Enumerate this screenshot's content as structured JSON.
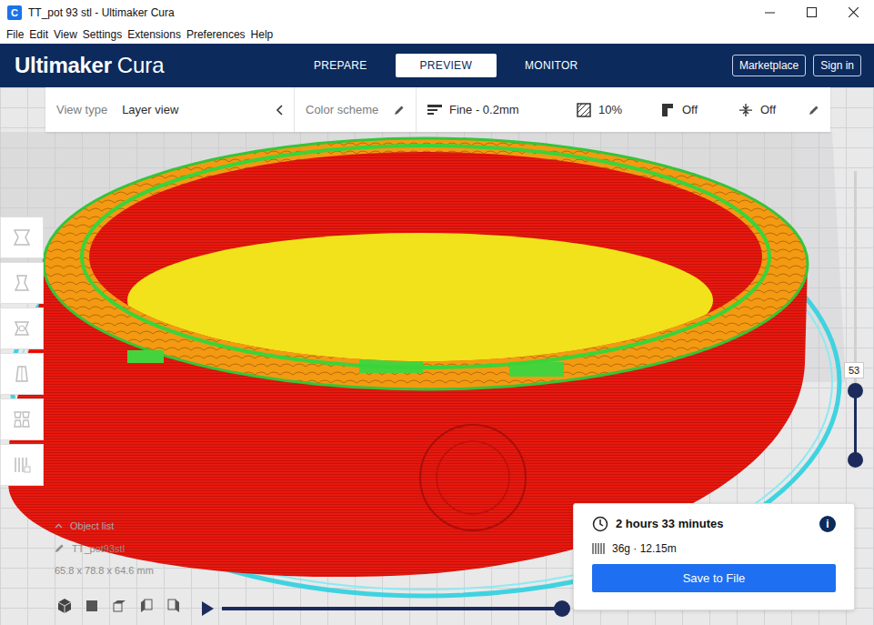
{
  "window": {
    "title": "TT_pot 93 stl - Ultimaker Cura",
    "app_icon": "C"
  },
  "menu": [
    "File",
    "Edit",
    "View",
    "Settings",
    "Extensions",
    "Preferences",
    "Help"
  ],
  "header": {
    "logo_brand": "Ultimaker",
    "logo_product": "Cura",
    "stages": [
      {
        "label": "PREPARE",
        "selected": false
      },
      {
        "label": "PREVIEW",
        "selected": true
      },
      {
        "label": "MONITOR",
        "selected": false
      }
    ],
    "buttons": [
      "Marketplace",
      "Sign in"
    ]
  },
  "print_setup": {
    "view_type_label": "View type",
    "view_type": "Layer view",
    "color_scheme_label": "Color scheme",
    "profile": "Fine - 0.2mm",
    "infill": "10%",
    "support": "Off",
    "adhesion": "Off"
  },
  "layer_slider": {
    "value": "53",
    "level": 0.24
  },
  "object_list": {
    "title": "Object list",
    "object": "TT_pot93stl",
    "dimensions": "65.8 x 78.8 x 64.6 mm"
  },
  "playback": {
    "playing": false,
    "level": 1
  },
  "print_info": {
    "time": "2 hours 33 minutes",
    "info": "i",
    "material": "36g · 12.15m",
    "button": "Save to File"
  }
}
